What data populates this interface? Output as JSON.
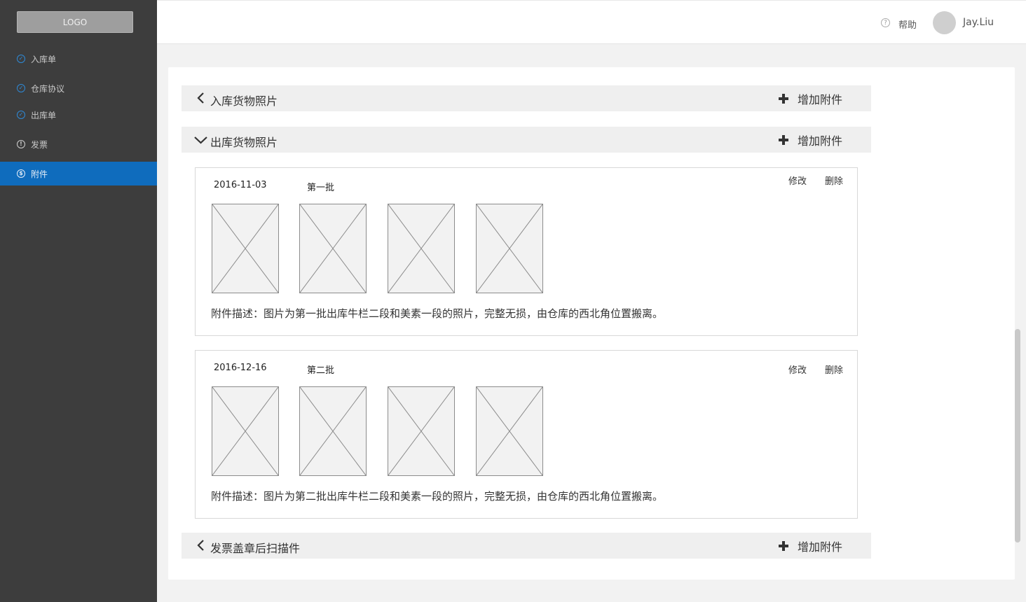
{
  "sidebar": {
    "logo": "LOGO",
    "items": [
      {
        "label": "入库单",
        "icon": "check-circle-icon"
      },
      {
        "label": "仓库协议",
        "icon": "check-circle-icon"
      },
      {
        "label": "出库单",
        "icon": "check-circle-icon"
      },
      {
        "label": "发票",
        "icon": "info-circle-icon"
      },
      {
        "label": "附件",
        "icon": "dollar-circle-icon",
        "active": true
      }
    ]
  },
  "header": {
    "help_label": "帮助",
    "help_icon": "question-circle-icon",
    "username": "Jay.Liu"
  },
  "sections": [
    {
      "title": "入库货物照片",
      "add_label": "增加附件",
      "expanded": false
    },
    {
      "title": "出库货物照片",
      "add_label": "增加附件",
      "expanded": true
    },
    {
      "title": "发票盖章后扫描件",
      "add_label": "增加附件",
      "expanded": false
    }
  ],
  "records": [
    {
      "date": "2016-11-03",
      "batch": "第一批",
      "edit_label": "修改",
      "delete_label": "删除",
      "description": "附件描述：图片为第一批出库牛栏二段和美素一段的照片，完整无损，由仓库的西北角位置搬离。"
    },
    {
      "date": "2016-12-16",
      "batch": "第二批",
      "edit_label": "修改",
      "delete_label": "删除",
      "description": "附件描述：图片为第二批出库牛栏二段和美素一段的照片，完整无损，由仓库的西北角位置搬离。"
    }
  ],
  "colors": {
    "sidebar_bg": "#3d3d3d",
    "active_item": "#0f6cbd",
    "check_icon": "#2e8ad8"
  }
}
